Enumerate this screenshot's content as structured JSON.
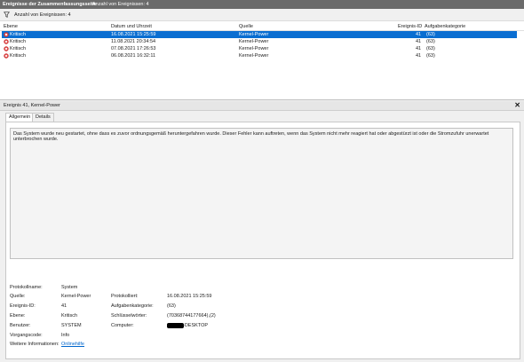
{
  "titlebar": {
    "title": "Ereignisse der Zusammenfassungsseite",
    "count_label": "Anzahl von Ereignissen: 4"
  },
  "toolbar": {
    "count_label": "Anzahl von Ereignissen: 4",
    "filter_icon": "filter-icon"
  },
  "grid": {
    "headers": [
      "Ebene",
      "Datum und Uhrzeit",
      "Quelle",
      "Ereignis-ID",
      "Aufgabenkategorie"
    ],
    "rows": [
      {
        "level": "Kritisch",
        "datetime": "16.08.2021 15:25:59",
        "source": "Kernel-Power",
        "id": "41",
        "category": "(63)"
      },
      {
        "level": "Kritisch",
        "datetime": "11.08.2021 20:34:54",
        "source": "Kernel-Power",
        "id": "41",
        "category": "(63)"
      },
      {
        "level": "Kritisch",
        "datetime": "07.08.2021 17:26:53",
        "source": "Kernel-Power",
        "id": "41",
        "category": "(63)"
      },
      {
        "level": "Kritisch",
        "datetime": "06.08.2021 16:32:11",
        "source": "Kernel-Power",
        "id": "41",
        "category": "(63)"
      }
    ],
    "selected_color": "#0a6ed1",
    "critical_icon": "critical-error-icon",
    "critical_color": "#d32f2f"
  },
  "detail": {
    "header": "Ereignis 41, Kernel-Power",
    "close": "✕",
    "tabs": [
      "Allgemein",
      "Details"
    ],
    "message": "Das System wurde neu gestartet, ohne dass es zuvor ordnungsgemäß heruntergefahren wurde. Dieser Fehler kann auftreten, wenn das System nicht mehr reagiert hat oder abgestürzt ist oder die Stromzufuhr unerwartet unterbrochen wurde.",
    "fields": {
      "log_name_label": "Protokollname:",
      "log_name": "System",
      "source_label": "Quelle:",
      "source": "Kernel-Power",
      "logged_label": "Protokolliert:",
      "logged": "16.08.2021 15:25:59",
      "event_id_label": "Ereignis-ID:",
      "event_id": "41",
      "task_label": "Aufgabenkategorie:",
      "task": "(63)",
      "level_label": "Ebene:",
      "level": "Kritisch",
      "keywords_label": "Schlüsselwörter:",
      "keywords": "(70368744177664),(2)",
      "user_label": "Benutzer:",
      "user": "SYSTEM",
      "computer_label": "Computer:",
      "computer": "-DESKTOP",
      "opcode_label": "Vorgangscode:",
      "opcode": "Info",
      "more_info_label": "Weitere Informationen:",
      "more_info_link": "Onlinehilfe"
    }
  }
}
